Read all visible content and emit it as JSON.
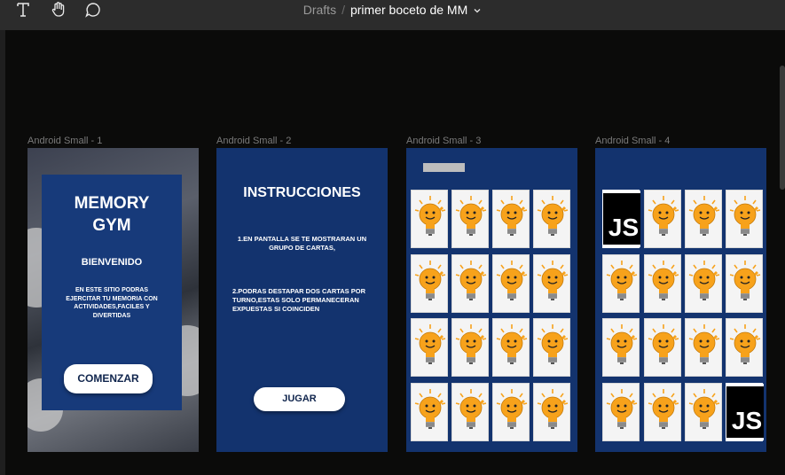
{
  "toolbar": {
    "tools": [
      "text-icon",
      "hand-icon",
      "comment-icon"
    ],
    "breadcrumb_root": "Drafts",
    "separator": "/",
    "file_name": "primer boceto de MM"
  },
  "frames": [
    {
      "label": "Android Small - 1"
    },
    {
      "label": "Android Small - 2"
    },
    {
      "label": "Android Small - 3"
    },
    {
      "label": "Android Small - 4"
    }
  ],
  "screen1": {
    "title_line1": "MEMORY",
    "title_line2": "GYM",
    "welcome": "BIENVENIDO",
    "description": "EN ESTE SITIO PODRAS EJERCITAR TU MEMORIA CON ACTIVIDADES,FACILES Y DIVERTIDAS",
    "button": "COMENZAR"
  },
  "screen2": {
    "title": "INSTRUCCIONES",
    "instruction1": "1.EN PANTALLA SE TE MOSTRARAN UN GRUPO DE CARTAS,",
    "instruction2": "2.PODRAS DESTAPAR DOS CARTAS POR TURNO,ESTAS SOLO PERMANECERAN EXPUESTAS SI COINCIDEN",
    "button": "JUGAR"
  },
  "screen3": {
    "cards": [
      [
        "bulb",
        "bulb",
        "bulb",
        "bulb"
      ],
      [
        "bulb",
        "bulb",
        "bulb",
        "bulb"
      ],
      [
        "bulb",
        "bulb",
        "bulb",
        "bulb"
      ],
      [
        "bulb",
        "bulb",
        "bulb",
        "bulb"
      ]
    ]
  },
  "screen4": {
    "js_text": "JS",
    "cards": [
      [
        "js",
        "bulb",
        "bulb",
        "bulb"
      ],
      [
        "bulb",
        "bulb",
        "bulb",
        "bulb"
      ],
      [
        "bulb",
        "bulb",
        "bulb",
        "bulb"
      ],
      [
        "bulb",
        "bulb",
        "bulb",
        "js"
      ]
    ]
  },
  "colors": {
    "canvas": "#0b0b0a",
    "frame_navy": "#13336e",
    "bulb": "#f7a21b"
  }
}
